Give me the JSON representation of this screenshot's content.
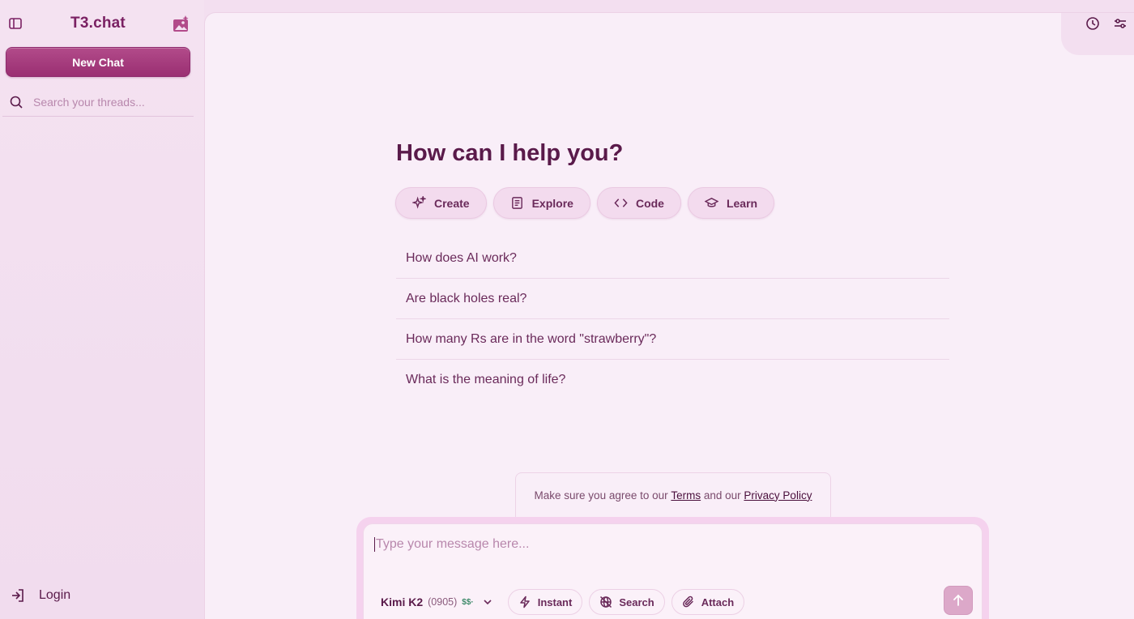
{
  "sidebar": {
    "title": "T3.chat",
    "new_chat_label": "New Chat",
    "search_placeholder": "Search your threads...",
    "login_label": "Login"
  },
  "main": {
    "heading": "How can I help you?",
    "categories": [
      {
        "label": "Create",
        "icon": "sparkles-icon"
      },
      {
        "label": "Explore",
        "icon": "newspaper-icon"
      },
      {
        "label": "Code",
        "icon": "code-icon"
      },
      {
        "label": "Learn",
        "icon": "graduation-cap-icon"
      }
    ],
    "suggestions": [
      "How does AI work?",
      "Are black holes real?",
      "How many Rs are in the word \"strawberry\"?",
      "What is the meaning of life?"
    ]
  },
  "notice": {
    "prefix": "Make sure you agree to our ",
    "terms": "Terms",
    "middle": " and our ",
    "privacy": "Privacy Policy"
  },
  "composer": {
    "placeholder": "Type your message here...",
    "model_name": "Kimi K2",
    "model_version": "(0905)",
    "model_cost": "$$·",
    "instant_label": "Instant",
    "search_label": "Search",
    "attach_label": "Attach"
  },
  "colors": {
    "accent": "#9a2f72",
    "text": "#5a1a4a",
    "background": "#f3dff0",
    "panel": "#f9eef8"
  }
}
